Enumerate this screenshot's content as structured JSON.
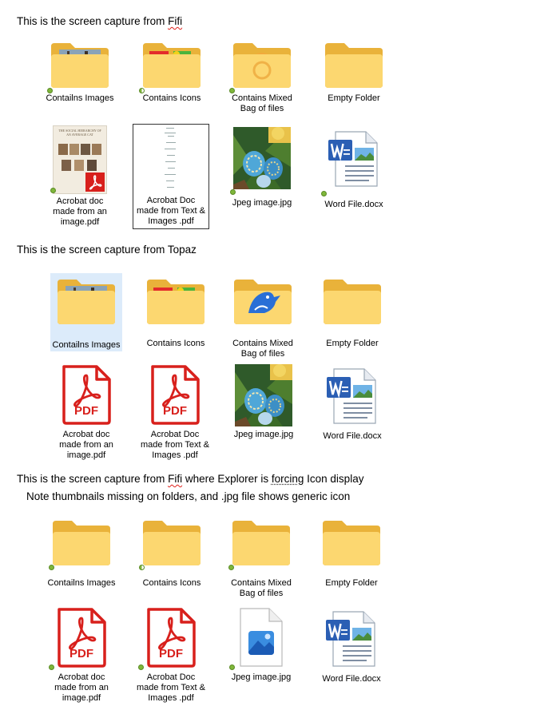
{
  "section1": {
    "caption_prefix": "This is the  screen capture from ",
    "caption_name": "Fifi",
    "row1": [
      {
        "label": "Contailns Images",
        "icon": "folder-with-photo-thumbnail-icon"
      },
      {
        "label": "Contains Icons",
        "icon": "folder-with-puzzle-icon"
      },
      {
        "label": "Contains Mixed Bag of files",
        "icon": "folder-with-mixed-files-icon"
      },
      {
        "label": "Empty Folder",
        "icon": "empty-folder-icon"
      }
    ],
    "row2": [
      {
        "label": "Acrobat doc made from an image.pdf",
        "icon": "pdf-image-thumbnail-icon"
      },
      {
        "label": "Acrobat Doc made from Text & Images .pdf",
        "icon": "pdf-text-thumbnail-icon"
      },
      {
        "label": "Jpeg image.jpg",
        "icon": "easter-eggs-photo-thumbnail"
      },
      {
        "label": "Word File.docx",
        "icon": "word-document-icon"
      }
    ],
    "pdf_thumb_text": "THE SOCIAL HIERARCHY OF AN AVERAGE CAT"
  },
  "section2": {
    "caption_prefix": "This is the  screen capture from ",
    "caption_name": "Topaz",
    "row1": [
      {
        "label": "Contailns Images",
        "icon": "folder-with-photo-thumbnail-icon"
      },
      {
        "label": "Contains Icons",
        "icon": "folder-with-puzzle-icon"
      },
      {
        "label": "Contains Mixed Bag of files",
        "icon": "folder-with-bird-icon"
      },
      {
        "label": "Empty Folder",
        "icon": "empty-folder-icon"
      }
    ],
    "row2": [
      {
        "label": "Acrobat doc made from an image.pdf",
        "icon": "pdf-icon"
      },
      {
        "label": "Acrobat Doc made from Text & Images .pdf",
        "icon": "pdf-icon"
      },
      {
        "label": "Jpeg image.jpg",
        "icon": "easter-eggs-photo-thumbnail"
      },
      {
        "label": "Word File.docx",
        "icon": "word-document-icon"
      }
    ]
  },
  "section3": {
    "caption_line1_a": "This is the  screen capture from ",
    "caption_line1_name": "Fifi",
    "caption_line1_b": " where Explorer is ",
    "caption_line1_word": "forcing",
    "caption_line1_c": " Icon display",
    "caption_line2": "Note thumbnails missing on folders, and .jpg file shows  generic icon",
    "row1": [
      {
        "label": "Contailns Images",
        "icon": "empty-folder-icon"
      },
      {
        "label": "Contains Icons",
        "icon": "empty-folder-icon"
      },
      {
        "label": "Contains Mixed Bag of files",
        "icon": "empty-folder-icon"
      },
      {
        "label": "Empty Folder",
        "icon": "empty-folder-icon"
      }
    ],
    "row2": [
      {
        "label": "Acrobat doc made from an image.pdf",
        "icon": "pdf-icon"
      },
      {
        "label": "Acrobat Doc made from Text & Images .pdf",
        "icon": "pdf-icon"
      },
      {
        "label": "Jpeg image.jpg",
        "icon": "generic-image-file-icon"
      },
      {
        "label": "Word File.docx",
        "icon": "word-document-icon"
      }
    ]
  },
  "pdf_badge": "PDF",
  "word_badge": "W",
  "colors": {
    "folder_back": "#e9b23a",
    "folder_front": "#fcd770",
    "pdf_red": "#d8201c",
    "word_blue": "#2b5fb4",
    "status_green": "#7fb73a",
    "selection": "#dcebfa"
  }
}
